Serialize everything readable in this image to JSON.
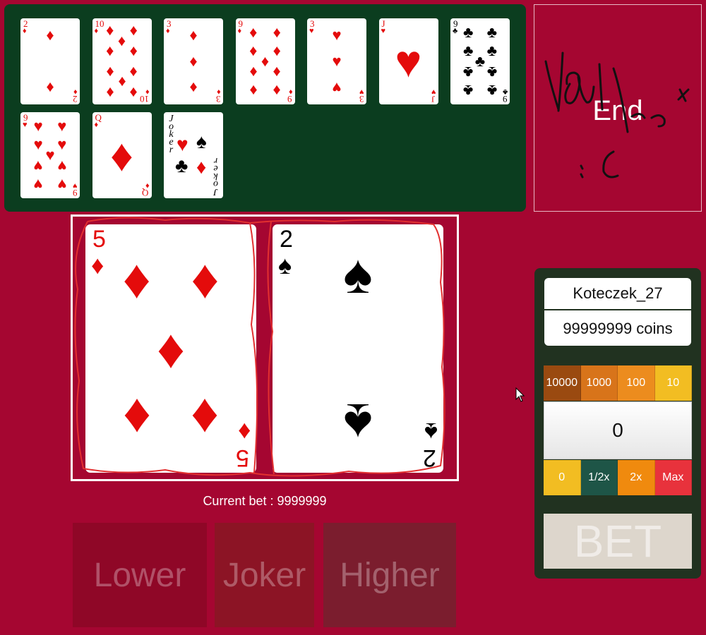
{
  "history": {
    "cards": [
      {
        "rank": "2",
        "suit": "diamond",
        "color": "red"
      },
      {
        "rank": "10",
        "suit": "diamond",
        "color": "red"
      },
      {
        "rank": "3",
        "suit": "diamond",
        "color": "red"
      },
      {
        "rank": "9",
        "suit": "diamond",
        "color": "red"
      },
      {
        "rank": "3",
        "suit": "heart",
        "color": "red"
      },
      {
        "rank": "J",
        "suit": "heart",
        "color": "red"
      },
      {
        "rank": "9",
        "suit": "club",
        "color": "black"
      },
      {
        "rank": "9",
        "suit": "heart",
        "color": "red"
      },
      {
        "rank": "Q",
        "suit": "diamond",
        "color": "red"
      },
      {
        "rank": "Joker",
        "suit": "joker",
        "color": "black"
      }
    ]
  },
  "end_panel": {
    "label": "End"
  },
  "table": {
    "left_card": {
      "rank": "5",
      "suit": "diamond",
      "color": "red"
    },
    "right_card": {
      "rank": "2",
      "suit": "spade",
      "color": "black"
    }
  },
  "current_bet": "Current bet : 9999999",
  "choices": {
    "lower": "Lower",
    "joker": "Joker",
    "higher": "Higher"
  },
  "player": {
    "name": "Koteczek_27",
    "coins": "99999999 coins"
  },
  "chips_top": [
    {
      "label": "10000",
      "color": "#9a4a10"
    },
    {
      "label": "1000",
      "color": "#d8741a"
    },
    {
      "label": "100",
      "color": "#ec8c1e"
    },
    {
      "label": "10",
      "color": "#f2bd22"
    }
  ],
  "bet_value": "0",
  "chips_bottom": [
    {
      "label": "0",
      "color": "#f2bd22"
    },
    {
      "label": "1/2x",
      "color": "#1e5547"
    },
    {
      "label": "2x",
      "color": "#f08a0e"
    },
    {
      "label": "Max",
      "color": "#e8323c"
    }
  ],
  "bet_button": "BET",
  "colors": {
    "background": "#a50631",
    "history_felt": "#0b3d1f",
    "side_panel": "#213220"
  }
}
